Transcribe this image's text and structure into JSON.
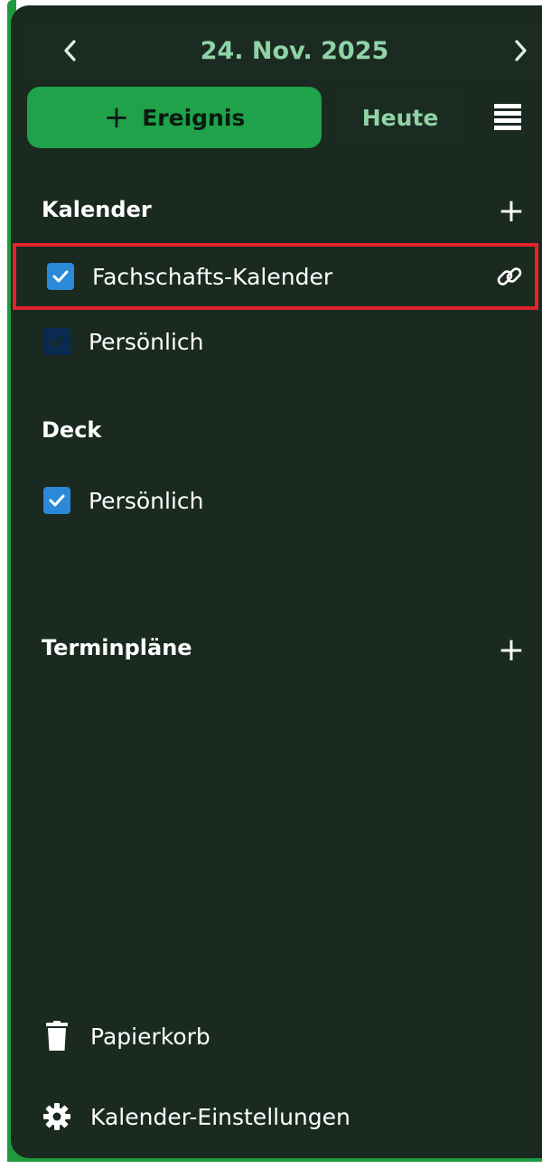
{
  "header": {
    "date": "24. Nov. 2025",
    "prev_icon": "chevron-left-icon",
    "next_icon": "chevron-right-icon"
  },
  "toolbar": {
    "new_event_label": "Ereignis",
    "new_event_icon": "plus-icon",
    "today_label": "Heute",
    "view_icon": "view-menu-icon"
  },
  "sections": {
    "calendars": {
      "title": "Kalender",
      "items": [
        {
          "label": "Fachschafts-Kalender",
          "checked": true,
          "color": "#2a8ad8",
          "highlighted": true,
          "has_link": true
        },
        {
          "label": "Persönlich",
          "checked": true,
          "color": "#0b2a52",
          "highlighted": false,
          "has_link": false
        }
      ]
    },
    "deck": {
      "title": "Deck",
      "items": [
        {
          "label": "Persönlich",
          "checked": true,
          "color": "#2a8ad8"
        }
      ]
    },
    "appointments": {
      "title": "Terminpläne"
    }
  },
  "footer": {
    "trash_label": "Papierkorb",
    "settings_label": "Kalender-Einstellungen"
  },
  "colors": {
    "accent": "#1fa24a",
    "panel": "#1a2a20",
    "header_text": "#8fd3a6",
    "highlight_border": "#e3232b"
  }
}
